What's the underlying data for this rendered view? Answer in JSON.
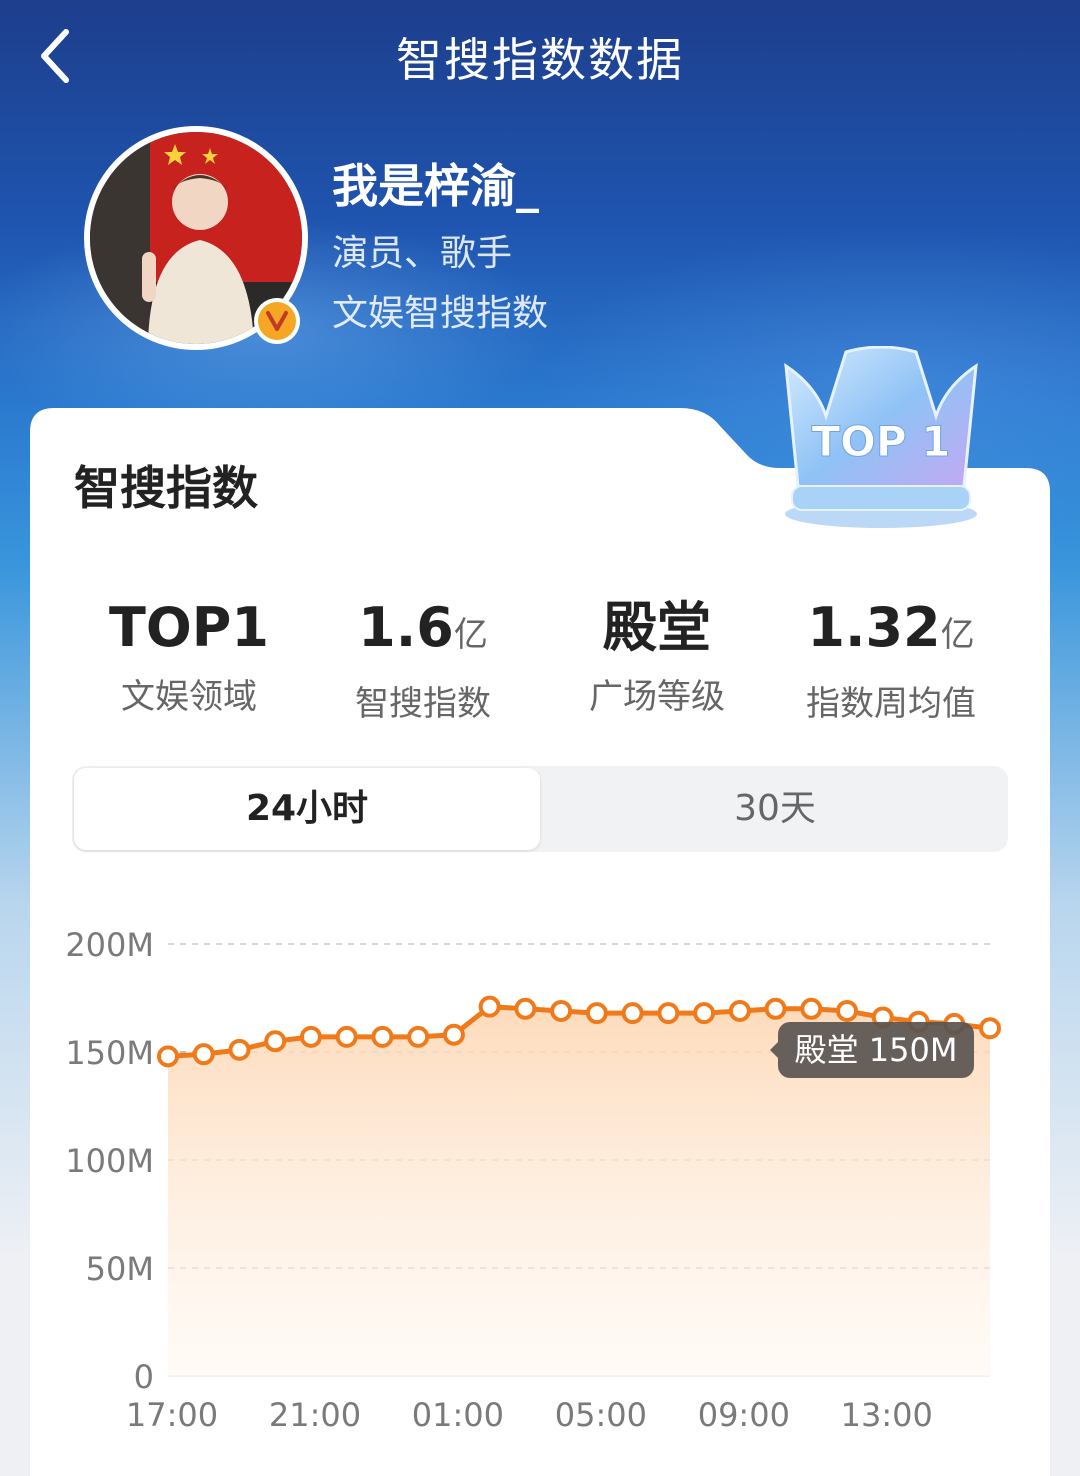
{
  "header": {
    "title": "智搜指数数据",
    "back_icon": "chevron-left-icon"
  },
  "profile": {
    "name": "我是梓渝_",
    "role": "演员、歌手",
    "subtitle": "文娱智搜指数",
    "badge": "V"
  },
  "card": {
    "title": "智搜指数",
    "trophy_text": "TOP 1"
  },
  "stats": [
    {
      "value": "TOP1",
      "unit": "",
      "label": "文娱领域"
    },
    {
      "value": "1.6",
      "unit": "亿",
      "label": "智搜指数"
    },
    {
      "value": "殿堂",
      "unit": "",
      "label": "广场等级"
    },
    {
      "value": "1.32",
      "unit": "亿",
      "label": "指数周均值"
    }
  ],
  "tabs": {
    "active": "24小时",
    "inactive": "30天"
  },
  "colors": {
    "accent": "#f07a1a",
    "fill": "#fde3cb",
    "badge": "#f5a623"
  },
  "chart_data": {
    "type": "line",
    "x_tick_labels": [
      "17:00",
      "21:00",
      "01:00",
      "05:00",
      "09:00",
      "13:00"
    ],
    "y_tick_labels": [
      "200M",
      "150M",
      "100M",
      "50M",
      "0"
    ],
    "ylim": [
      0,
      200
    ],
    "unit": "M",
    "x": [
      0,
      1,
      2,
      3,
      4,
      5,
      6,
      7,
      8,
      9,
      10,
      11,
      12,
      13,
      14,
      15,
      16,
      17,
      18,
      19,
      20,
      21,
      22,
      23
    ],
    "values": [
      148,
      149,
      151,
      155,
      157,
      157,
      157,
      157,
      158,
      171,
      170,
      169,
      168,
      168,
      168,
      168,
      169,
      170,
      170,
      169,
      166,
      164,
      163,
      161
    ],
    "reference_line": {
      "value": 150,
      "label": "殿堂 150M"
    },
    "grid": true,
    "area_fill": true
  }
}
